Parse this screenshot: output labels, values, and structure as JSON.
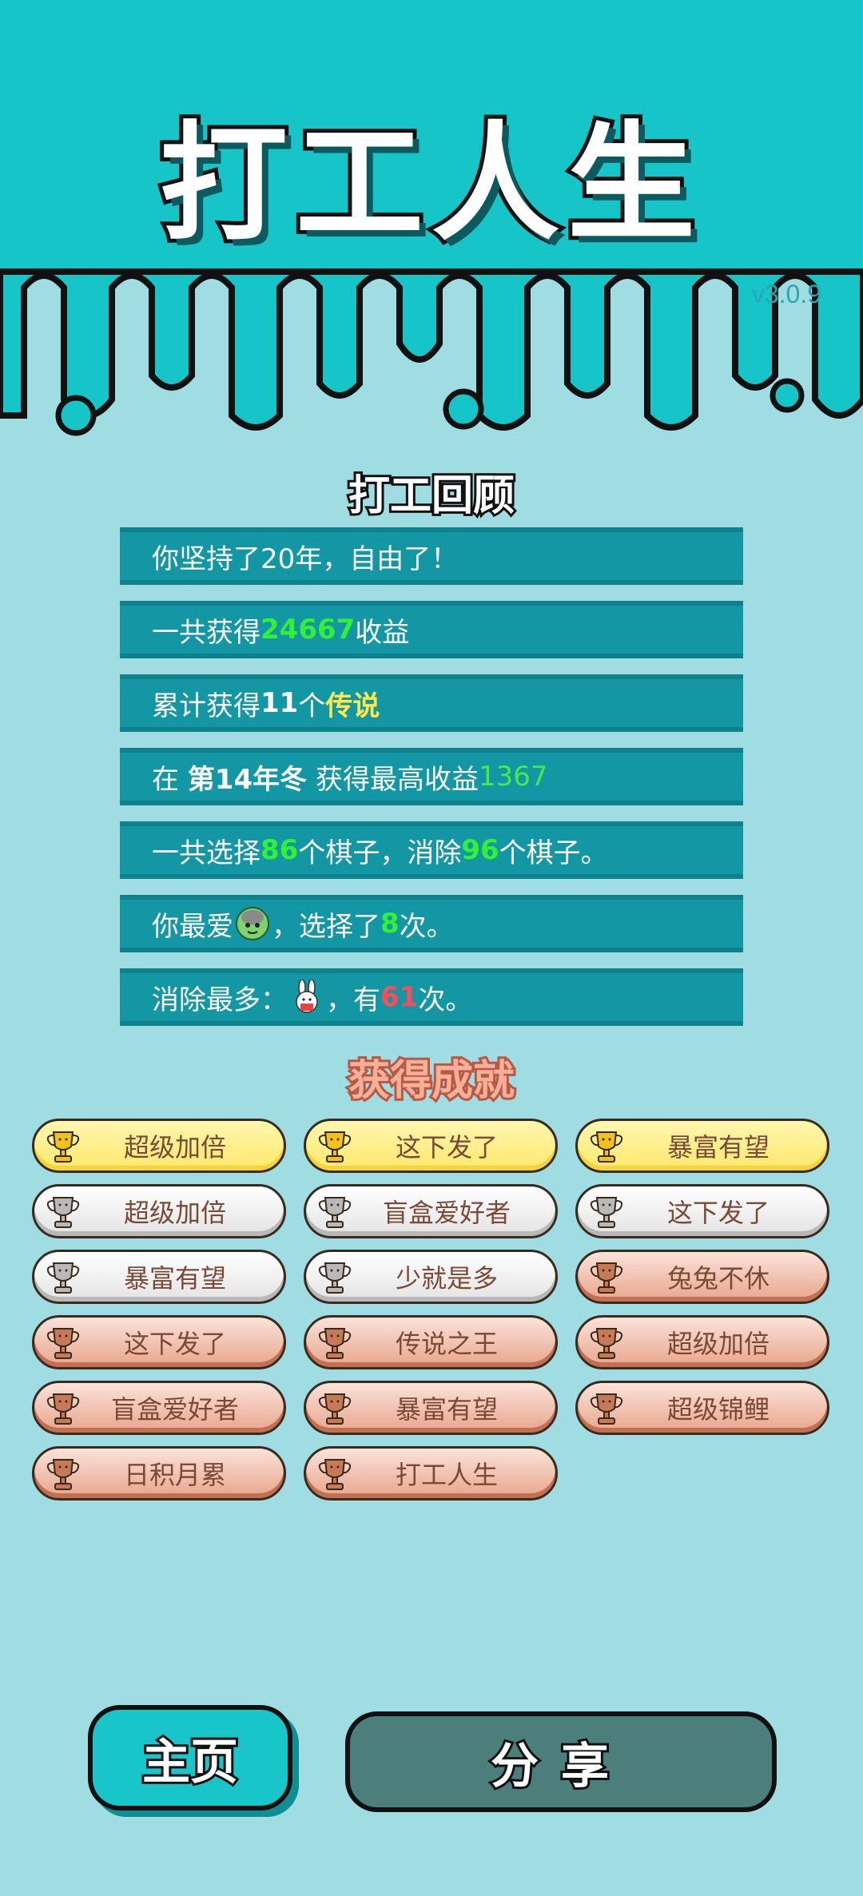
{
  "app": {
    "title": "打工人生",
    "version": "v3.0.9"
  },
  "colors": {
    "header": "#15c5c8",
    "background": "#9fdde3",
    "row": "#1397a5",
    "accent_green": "#33f033",
    "accent_yellow": "#ffe94a",
    "accent_red": "#ff4a57"
  },
  "review": {
    "title": "打工回顾",
    "r1": "你坚持了20年，自由了！",
    "r2": {
      "pre": "一共获得",
      "num": "24667",
      "post": "收益"
    },
    "r3": {
      "pre": "累计获得",
      "num": "11",
      "mid": "个",
      "tag": "传说"
    },
    "r4": {
      "pre": "在",
      "season": "第14年冬",
      "mid": "获得最高收益",
      "num": "1367"
    },
    "r5": {
      "pre": "一共选择",
      "n1": "86",
      "mid": "个棋子，消除",
      "n2": "96",
      "post": "个棋子。"
    },
    "r6": {
      "pre": "你最爱",
      "icon": "green-creature-icon",
      "mid": "，选择了",
      "num": "8",
      "post": "次。"
    },
    "r7": {
      "pre": "消除最多：",
      "icon": "rabbit-icon",
      "mid": "，有",
      "num": "61",
      "post": "次。"
    }
  },
  "achievements": {
    "title": "获得成就",
    "items": [
      {
        "label": "超级加倍",
        "tier": "gold"
      },
      {
        "label": "这下发了",
        "tier": "gold"
      },
      {
        "label": "暴富有望",
        "tier": "gold"
      },
      {
        "label": "超级加倍",
        "tier": "silver"
      },
      {
        "label": "盲盒爱好者",
        "tier": "silver"
      },
      {
        "label": "这下发了",
        "tier": "silver"
      },
      {
        "label": "暴富有望",
        "tier": "silver"
      },
      {
        "label": "少就是多",
        "tier": "silver"
      },
      {
        "label": "兔兔不休",
        "tier": "bronze"
      },
      {
        "label": "这下发了",
        "tier": "bronze"
      },
      {
        "label": "传说之王",
        "tier": "bronze"
      },
      {
        "label": "超级加倍",
        "tier": "bronze"
      },
      {
        "label": "盲盒爱好者",
        "tier": "bronze"
      },
      {
        "label": "暴富有望",
        "tier": "bronze"
      },
      {
        "label": "超级锦鲤",
        "tier": "bronze"
      },
      {
        "label": "日积月累",
        "tier": "bronze"
      },
      {
        "label": "打工人生",
        "tier": "bronze"
      }
    ]
  },
  "buttons": {
    "home": "主页",
    "share": "分享"
  }
}
